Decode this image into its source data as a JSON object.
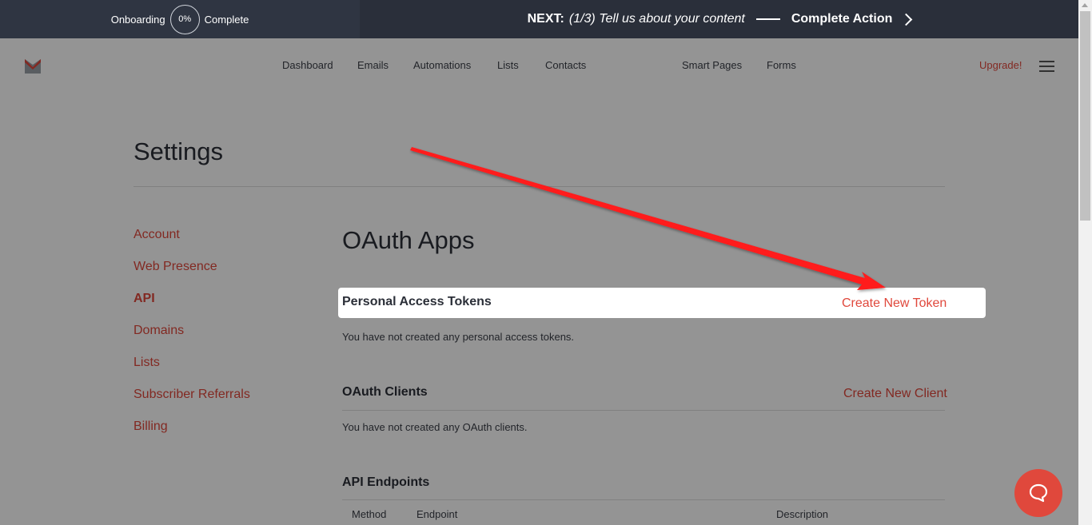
{
  "onboarding": {
    "prefix": "Onboarding",
    "percent": "0%",
    "suffix": "Complete",
    "next_label": "NEXT:",
    "next_step": "(1/3) Tell us about your content",
    "action_label": "Complete Action"
  },
  "nav": {
    "items": [
      "Dashboard",
      "Emails",
      "Automations",
      "Lists",
      "Contacts",
      "Smart Pages",
      "Forms"
    ],
    "upgrade": "Upgrade!"
  },
  "page": {
    "title": "Settings"
  },
  "sidebar": {
    "items": [
      "Account",
      "Web Presence",
      "API",
      "Domains",
      "Lists",
      "Subscriber Referrals",
      "Billing"
    ],
    "active": "API"
  },
  "main": {
    "heading": "OAuth Apps",
    "personal_tokens": {
      "title": "Personal Access Tokens",
      "action": "Create New Token",
      "empty_text": "You have not created any personal access tokens."
    },
    "oauth_clients": {
      "title": "OAuth Clients",
      "action": "Create New Client",
      "empty_text": "You have not created any OAuth clients."
    },
    "api_endpoints": {
      "title": "API Endpoints",
      "columns": [
        "Method",
        "Endpoint",
        "Description"
      ]
    }
  },
  "colors": {
    "accent": "#e0483c",
    "dark_bar": "#2a2f3a",
    "arrow": "#ff1a1a"
  }
}
